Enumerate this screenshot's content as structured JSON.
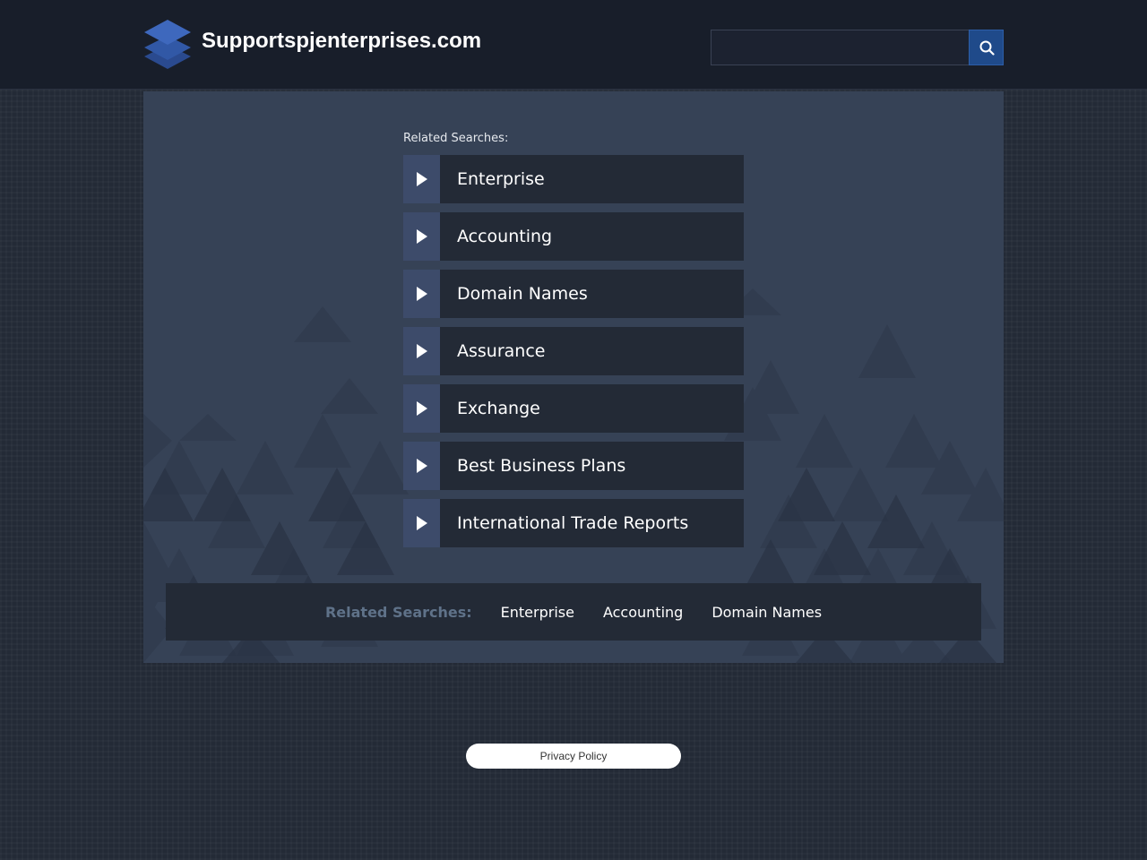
{
  "header": {
    "site_title": "Supportspjenterprises.com",
    "logo_icon": "stacked-layers-icon",
    "search": {
      "placeholder": "",
      "value": "",
      "button_icon": "search-icon"
    }
  },
  "main": {
    "related_heading": "Related Searches:",
    "links": [
      {
        "label": "Enterprise",
        "icon": "play-arrow-icon"
      },
      {
        "label": "Accounting",
        "icon": "play-arrow-icon"
      },
      {
        "label": "Domain Names",
        "icon": "play-arrow-icon"
      },
      {
        "label": "Assurance",
        "icon": "play-arrow-icon"
      },
      {
        "label": "Exchange",
        "icon": "play-arrow-icon"
      },
      {
        "label": "Best Business Plans",
        "icon": "play-arrow-icon"
      },
      {
        "label": "International Trade Reports",
        "icon": "play-arrow-icon"
      }
    ]
  },
  "footer_bar": {
    "heading": "Related Searches:",
    "links": [
      "Enterprise",
      "Accounting",
      "Domain Names"
    ]
  },
  "privacy": {
    "label": "Privacy Policy"
  },
  "colors": {
    "page_bg": "#232a36",
    "header_bg": "#181e2a",
    "panel_bg": "#364256",
    "item_bg": "#232a36",
    "arrow_bg": "#3d4b6a",
    "search_button": "#1f4a8a",
    "footer_heading": "#5f7289"
  }
}
